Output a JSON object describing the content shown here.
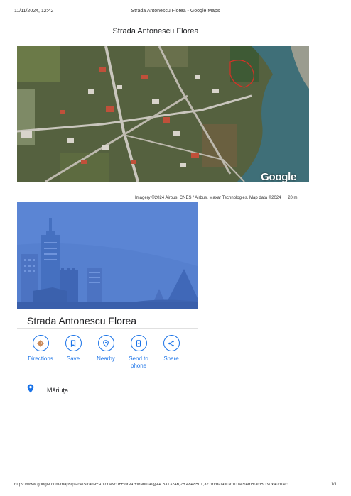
{
  "print_header": {
    "datetime": "11/11/2024, 12:42",
    "title": "Strada Antonescu Florea - Google Maps"
  },
  "document_title": "Strada Antonescu Florea",
  "map": {
    "logo": "Google",
    "attribution": "Imagery ©2024 Airbus, CNES / Airbus, Maxar Technologies, Map data ©2024",
    "scale": "20 m"
  },
  "place": {
    "name": "Strada Antonescu Florea",
    "locality": "Măriuța"
  },
  "actions": [
    {
      "label": "Directions",
      "icon": "directions-icon"
    },
    {
      "label": "Save",
      "icon": "bookmark-icon"
    },
    {
      "label": "Nearby",
      "icon": "nearby-icon"
    },
    {
      "label": "Send to phone",
      "icon": "send-to-phone-icon"
    },
    {
      "label": "Share",
      "icon": "share-icon"
    }
  ],
  "footer": {
    "url": "https://www.google.com/maps/place/Strada+Antonescu+Florea,+Măriuța/@44.5313246,26.4848501,327m/data=!3m1!1e3!4m6!3m5!1s0x40b1ec...",
    "page": "1/1"
  },
  "colors": {
    "accent": "#1a73e8",
    "hero_bg": "#5b85d4",
    "river": "#3f6f78"
  }
}
